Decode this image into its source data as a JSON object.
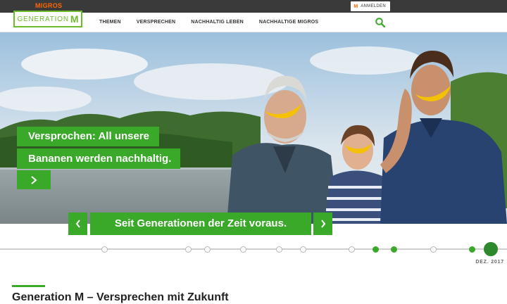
{
  "topbar": {
    "brand": "MIGROS",
    "login_m": "M",
    "login_label": "ANMELDEN"
  },
  "logo": {
    "text": "GENERATION",
    "letter": "M"
  },
  "nav": {
    "items": [
      "THEMEN",
      "VERSPRECHEN",
      "NACHHALTIG LEBEN",
      "NACHHALTIGE MIGROS"
    ]
  },
  "hero": {
    "headline_line1": "Versprochen: All unsere",
    "headline_line2": "Bananen werden nachhaltig.",
    "tagline": "Seit Generationen der Zeit voraus."
  },
  "timeline": {
    "current_label": "DEZ. 2017"
  },
  "main": {
    "title": "Generation M – Versprechen mit Zukunft"
  },
  "colors": {
    "accent": "#3aa829",
    "brand": "#ff6600",
    "logo": "#6cbb2c"
  }
}
